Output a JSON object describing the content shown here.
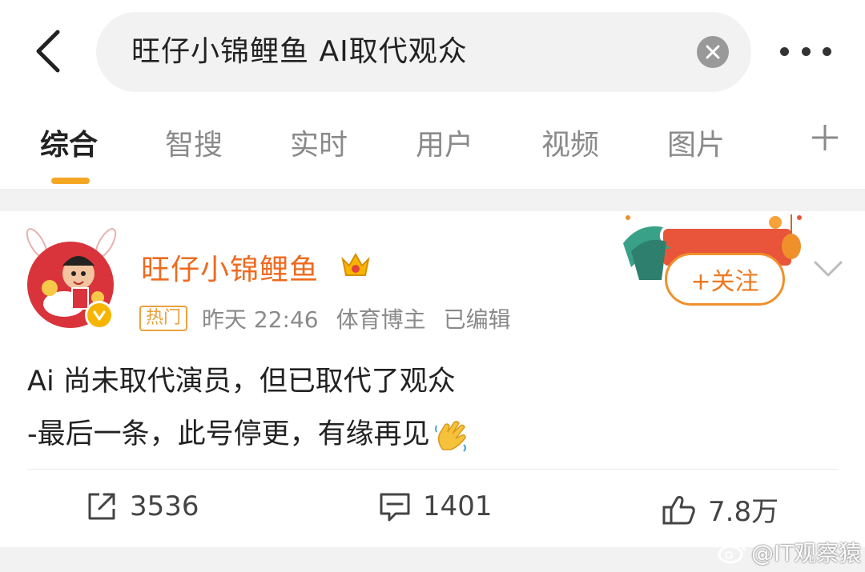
{
  "search": {
    "query": "旺仔小锦鲤鱼 AI取代观众"
  },
  "tabs": [
    {
      "label": "综合",
      "active": true
    },
    {
      "label": "智搜",
      "active": false
    },
    {
      "label": "实时",
      "active": false
    },
    {
      "label": "用户",
      "active": false
    },
    {
      "label": "视频",
      "active": false
    },
    {
      "label": "图片",
      "active": false
    }
  ],
  "post": {
    "username": "旺仔小锦鲤鱼",
    "badge": "热门",
    "time": "昨天 22:46",
    "role": "体育博主",
    "edited": "已编辑",
    "follow_label": "+关注",
    "lines": [
      "Ai 尚未取代演员，但已取代了观众",
      "-最后一条，此号停更，有缘再见"
    ],
    "reposts": "3536",
    "comments": "1401",
    "likes": "7.8万"
  },
  "watermark": "@IT观察猿",
  "colors": {
    "accent": "#f5a623",
    "username": "#ee6a1f",
    "follow": "#f0902b",
    "badge": "#e8a13b",
    "avatar_bg": "#d9343b"
  }
}
